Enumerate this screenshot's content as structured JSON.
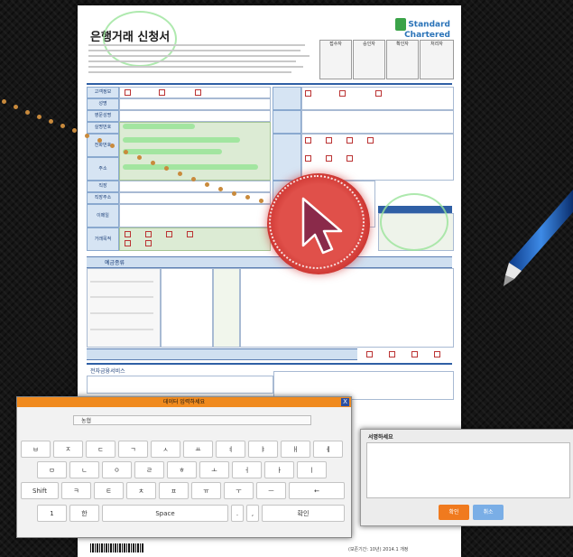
{
  "form": {
    "title": "은행거래 신청서",
    "logo_line1": "Standard",
    "logo_line2": "Chartered",
    "approval_headers": [
      "접수자",
      "승인자",
      "확인자",
      "처리자"
    ],
    "section_labels": [
      "고객정보",
      "성명",
      "영문성명",
      "실명번호",
      "전화번호",
      "주소",
      "직장",
      "직장주소",
      "이메일",
      "거래목적"
    ],
    "deposit_header": "예금종류",
    "service_header": "전자금융서비스",
    "footer_text": "(보존기간: 10년)  2014.1 개정"
  },
  "keyboard": {
    "title": "데이터 입력하세요",
    "close": "X",
    "input_value": "농협",
    "row1": [
      "ㅂ",
      "ㅈ",
      "ㄷ",
      "ㄱ",
      "ㅅ",
      "ㅛ",
      "ㅕ",
      "ㅑ",
      "ㅐ",
      "ㅔ"
    ],
    "row2": [
      "ㅁ",
      "ㄴ",
      "ㅇ",
      "ㄹ",
      "ㅎ",
      "ㅗ",
      "ㅓ",
      "ㅏ",
      "ㅣ"
    ],
    "row3": [
      "Shift",
      "ㅋ",
      "ㅌ",
      "ㅊ",
      "ㅍ",
      "ㅠ",
      "ㅜ",
      "ㅡ",
      "←"
    ],
    "key_num": "1",
    "key_lang": "한",
    "key_space": "Space",
    "key_dot": ".",
    "key_comma": ",",
    "key_ok": "확인"
  },
  "signature": {
    "title": "서명하세요",
    "ok_label": "확인",
    "cancel_label": "취소",
    "ok_color": "#f07a1e",
    "cancel_color": "#7aaee6"
  },
  "theme": {
    "accent": "#f08a1e",
    "brand_blue": "#2f5fa5",
    "cursor_red": "#d63b35"
  }
}
